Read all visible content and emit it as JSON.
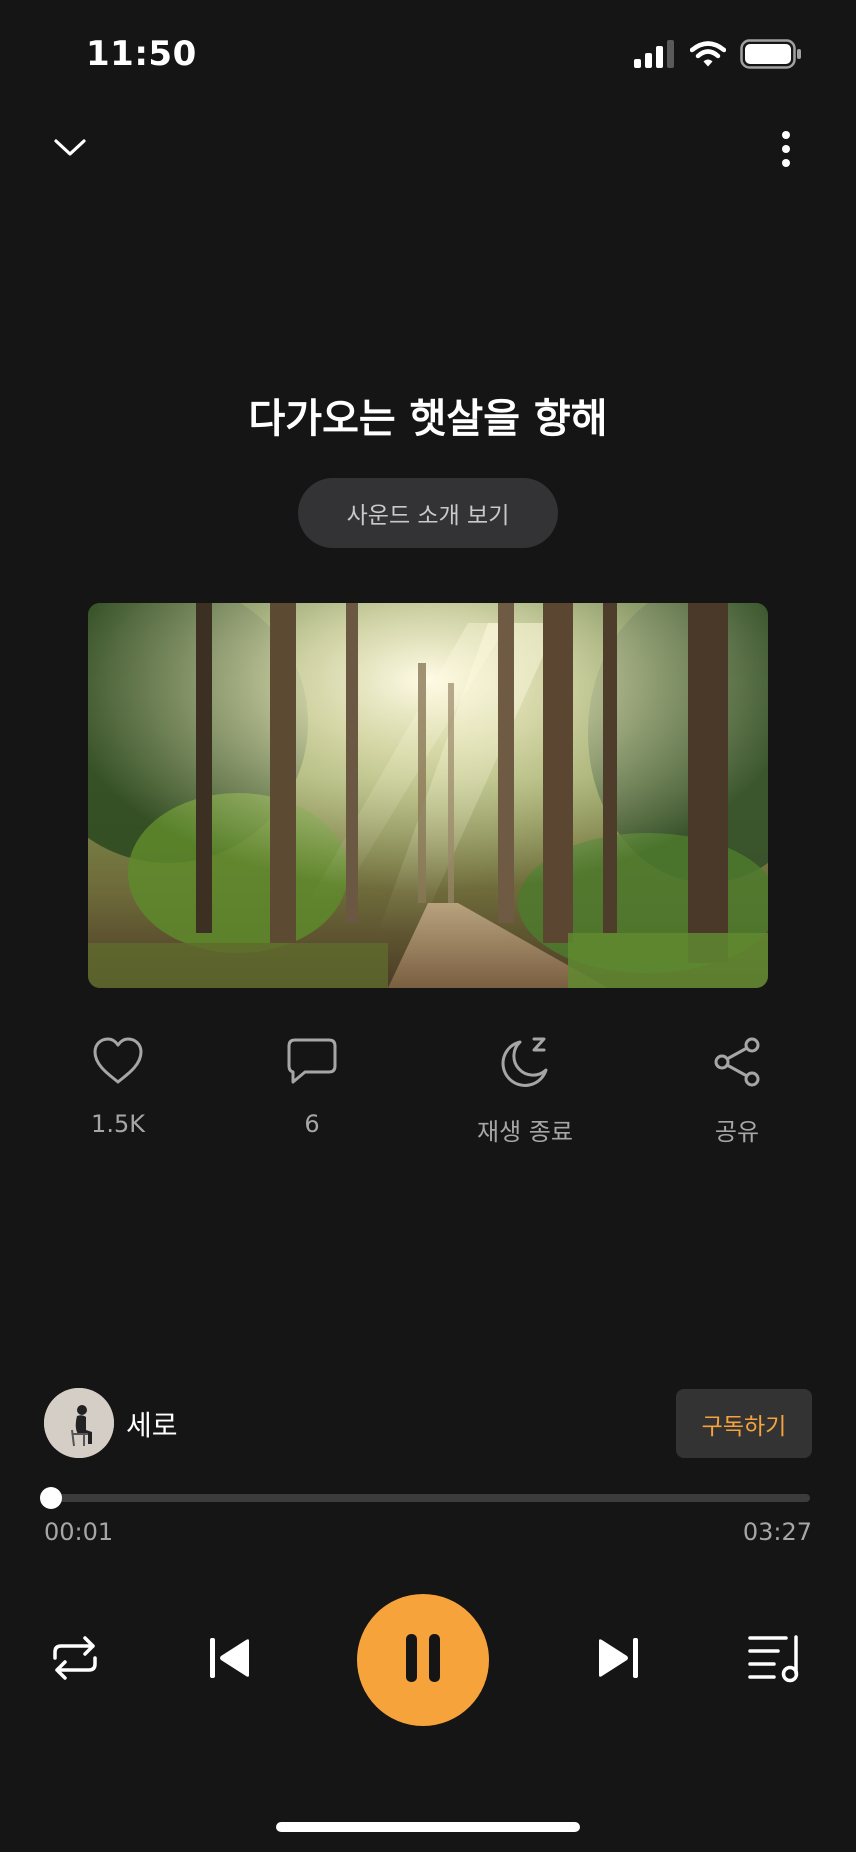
{
  "status_bar": {
    "time": "11:50"
  },
  "player": {
    "title": "다가오는 햇살을 향해",
    "intro_button": "사운드 소개 보기",
    "artwork_icon": "forest-sunlight-image"
  },
  "actions": [
    {
      "icon": "heart-icon",
      "label": "1.5K"
    },
    {
      "icon": "comment-icon",
      "label": "6"
    },
    {
      "icon": "sleep-timer-icon",
      "label": "재생 종료"
    },
    {
      "icon": "share-icon",
      "label": "공유"
    }
  ],
  "creator": {
    "name": "세로",
    "subscribe_label": "구독하기"
  },
  "progress": {
    "elapsed": "00:01",
    "duration": "03:27",
    "fraction": 0.005
  },
  "controls": {
    "repeat_icon": "repeat-icon",
    "previous_icon": "skip-previous-icon",
    "play_pause_icon": "pause-icon",
    "next_icon": "skip-next-icon",
    "playlist_icon": "playlist-icon"
  },
  "colors": {
    "background": "#151515",
    "accent": "#f6a33c",
    "muted_text": "#a6a6a6"
  }
}
